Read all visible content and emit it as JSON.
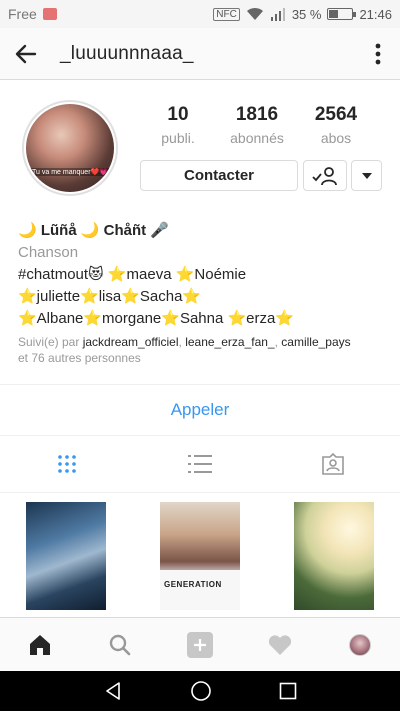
{
  "status_bar": {
    "carrier": "Free",
    "nfc": "NFC",
    "battery_pct": "35 %",
    "battery_level": 0.35,
    "time": "21:46"
  },
  "header": {
    "title": "_luuuunnnaaa_",
    "back_icon": "arrow-left-icon",
    "more_icon": "more-vertical-icon"
  },
  "profile": {
    "avatar_caption": "Tu va me manquer❤️💗",
    "stats": [
      {
        "num": "10",
        "label": "publi."
      },
      {
        "num": "1816",
        "label": "abonnés"
      },
      {
        "num": "2564",
        "label": "abos"
      }
    ],
    "contact_label": "Contacter"
  },
  "bio": {
    "name": "🌙 Lũñå 🌙 Chåñt 🎤",
    "category": "Chanson",
    "line1": "#chatmout😻 ⭐maeva ⭐Noémie",
    "line2": "⭐juliette⭐lisa⭐Sacha⭐",
    "line3": "⭐Albane⭐morgane⭐Sahna ⭐erza⭐",
    "followed_prefix": "Suivi(e) par ",
    "followed_by": "jackdream_officiel",
    "followed_sep1": ", ",
    "followed_by2": "leane_erza_fan_",
    "followed_sep2": ", ",
    "followed_by3": "camille_pays",
    "followed_suffix": "et 76 autres personnes"
  },
  "call_label": "Appeler",
  "tabs": [
    "grid-icon",
    "list-icon",
    "tagged-icon"
  ],
  "grid_shirt_text": "GENERATION",
  "bottom_nav": [
    "home-icon",
    "search-icon",
    "add-icon",
    "heart-icon",
    "profile-avatar"
  ],
  "colors": {
    "link_blue": "#3897f0",
    "muted": "#999999",
    "text": "#262626",
    "border": "#dbdbdb"
  }
}
